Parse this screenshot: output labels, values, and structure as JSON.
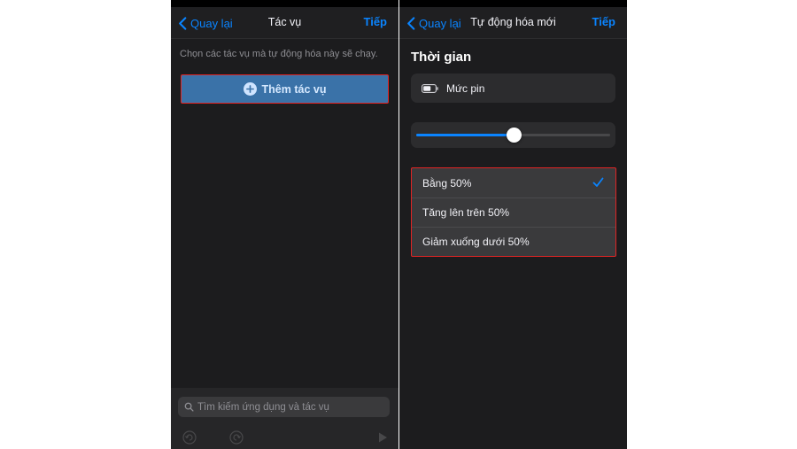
{
  "left_screen": {
    "nav": {
      "back_label": "Quay lại",
      "title": "Tác vụ",
      "next_label": "Tiếp"
    },
    "hint": "Chọn các tác vụ mà tự động hóa này sẽ chạy.",
    "add_action_label": "Thêm tác vụ",
    "search_placeholder": "Tìm kiếm ứng dụng và tác vụ",
    "toolbar_icons": [
      "undo-icon",
      "redo-icon",
      "play-icon"
    ]
  },
  "right_screen": {
    "nav": {
      "back_label": "Quay lại",
      "title": "Tự động hóa mới",
      "next_label": "Tiếp"
    },
    "section_title": "Thời gian",
    "trigger_label": "Mức pin",
    "slider_value_percent": 50,
    "options": [
      {
        "label": "Bằng 50%",
        "selected": true
      },
      {
        "label": "Tăng lên trên 50%",
        "selected": false
      },
      {
        "label": "Giảm xuống dưới 50%",
        "selected": false
      }
    ]
  },
  "colors": {
    "accent": "#0a84ff",
    "background": "#1c1c1e",
    "highlight_border": "#e02424",
    "button_fill": "#3a72a8"
  }
}
